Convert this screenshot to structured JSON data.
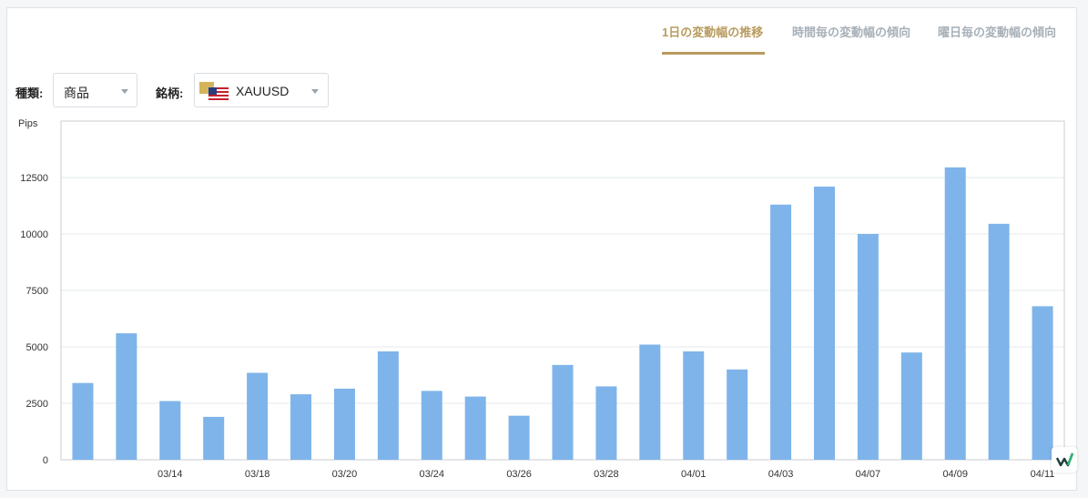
{
  "tabs": [
    {
      "label": "1日の変動幅の推移",
      "active": true
    },
    {
      "label": "時間毎の変動幅の傾向",
      "active": false
    },
    {
      "label": "曜日毎の変動幅の傾向",
      "active": false
    }
  ],
  "filters": {
    "type_label": "種類:",
    "type_value": "商品",
    "symbol_label": "銘柄:",
    "symbol_value": "XAUUSD",
    "symbol_icon": "gold-us-flag-icon"
  },
  "colors": {
    "bar": "#7eb4ea",
    "accent": "#b89b5e",
    "tab_inactive": "#a7b0b8"
  },
  "chart_data": {
    "type": "bar",
    "ylabel": "Pips",
    "ylim": [
      0,
      15000
    ],
    "yticks": [
      0,
      2500,
      5000,
      7500,
      10000,
      12500
    ],
    "grid": true,
    "values": [
      3400,
      5600,
      2600,
      1900,
      3850,
      2900,
      3150,
      4800,
      3050,
      2800,
      1950,
      4200,
      3250,
      5100,
      4800,
      4000,
      11300,
      12100,
      10000,
      4750,
      12950,
      10450,
      6800
    ],
    "tick_labels": [
      {
        "label": "03/14",
        "index": 2
      },
      {
        "label": "03/18",
        "index": 4
      },
      {
        "label": "03/20",
        "index": 6
      },
      {
        "label": "03/24",
        "index": 8
      },
      {
        "label": "03/26",
        "index": 10
      },
      {
        "label": "03/28",
        "index": 12
      },
      {
        "label": "04/01",
        "index": 14
      },
      {
        "label": "04/03",
        "index": 16
      },
      {
        "label": "04/07",
        "index": 18
      },
      {
        "label": "04/09",
        "index": 20
      },
      {
        "label": "04/11",
        "index": 22
      }
    ]
  }
}
